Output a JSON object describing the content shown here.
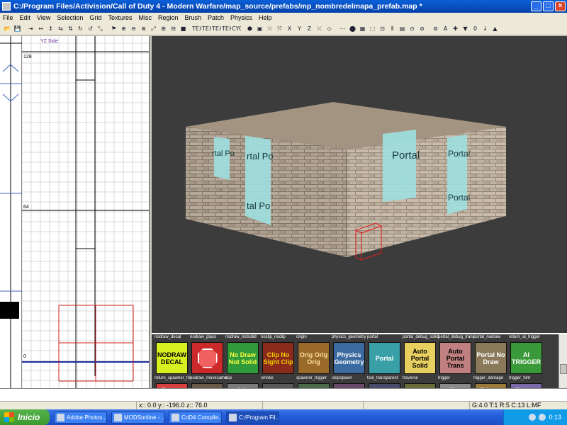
{
  "window": {
    "title": "C:/Program Files/Activision/Call of Duty 4 - Modern Warfare/map_source/prefabs/mp_nombredelmapa_prefab.map *",
    "min": "_",
    "max": "□",
    "close": "×"
  },
  "menu": [
    "File",
    "Edit",
    "View",
    "Selection",
    "Grid",
    "Textures",
    "Misc",
    "Region",
    "Brush",
    "Patch",
    "Physics",
    "Help"
  ],
  "toolbar": [
    "📂",
    "💾",
    "⇥",
    "↔",
    "↕",
    "⇆",
    "⇅",
    "↻",
    "↺",
    "⤡",
    "⚑",
    "⊕",
    "⊖",
    "⊗",
    "⤢",
    "⊞",
    "⊟",
    "■",
    "TEX",
    "TEX",
    "TEX",
    "TEX",
    "CYC",
    "⬢",
    "▣",
    "⤬",
    "⤧",
    "X",
    "Y",
    "Z",
    "⤫",
    "◇",
    "⋯",
    "⬤",
    "▦",
    "⬚",
    "⊡",
    "⫴",
    "▤",
    "⊙",
    "⊘",
    "⊚",
    "A",
    "✚",
    "▼",
    "0",
    "↓",
    "▲"
  ],
  "gridview": {
    "label": "YZ Side",
    "ruler_top": "128",
    "ruler_mid": "64",
    "ruler_low": "64",
    "ruler_zero": "0"
  },
  "camview": {
    "portals": [
      "Portal",
      "Portal",
      "Portal",
      "rtal Po",
      "rtal Po",
      "tal Po",
      "tal Po"
    ]
  },
  "textures": [
    {
      "name": "nodraw_decal",
      "tile": "NODRAW DECAL",
      "bg": "#d8f020",
      "fg": "#000000"
    },
    {
      "name": "nodraw_glass",
      "tile": "",
      "bg": "#cc2a2a",
      "fg": "#ffffff"
    },
    {
      "name": "nodraw_notsolid",
      "tile": "No Draw Not Solid",
      "bg": "#2e9a3a",
      "fg": "#ffff40"
    },
    {
      "name": "noclip_noclip",
      "tile": "Clip No Sight Clip",
      "bg": "#8a2a1a",
      "fg": "#f0d000"
    },
    {
      "name": "origin",
      "tile": "Orig Orig Orig",
      "bg": "#9a6a2a",
      "fg": "#ffe0a0"
    },
    {
      "name": "physics_geometry",
      "tile": "Physics Geometry",
      "bg": "#3a6aa0",
      "fg": "#ffffff"
    },
    {
      "name": "portal",
      "tile": "Portal",
      "bg": "#3aa0a8",
      "fg": "#ffffff"
    },
    {
      "name": "portal_debug_solid",
      "tile": "Auto Portal Solid",
      "bg": "#e8d060",
      "fg": "#000000"
    },
    {
      "name": "portal_debug_trans",
      "tile": "Auto Portal Trans",
      "bg": "#c08080",
      "fg": "#000000"
    },
    {
      "name": "portal_nodraw",
      "tile": "Portal No Draw",
      "bg": "#8a7a5a",
      "fg": "#ffffff"
    },
    {
      "name": "return_ai_trigger",
      "tile": "AI TRIGGER",
      "bg": "#3a9a3a",
      "fg": "#ffffff"
    }
  ],
  "textures_row2": [
    {
      "name": "return_spawner_trigger",
      "tile": "Return",
      "bg": "#d84040",
      "fg": "#ffffff"
    },
    {
      "name": "nodraw_movecarter",
      "tile": "",
      "bg": "#6a5a4a",
      "fg": "#ffffff"
    },
    {
      "name": "clip",
      "tile": "Clip",
      "bg": "#7a7a7a",
      "fg": "#ffffff"
    },
    {
      "name": "smoke",
      "tile": "",
      "bg": "#5a5a5a",
      "fg": "#ffffff"
    },
    {
      "name": "spawner_trigger",
      "tile": "",
      "bg": "#4a6a4a",
      "fg": "#ffffff"
    },
    {
      "name": "stopspawn",
      "tile": "",
      "bg": "#6a4a6a",
      "fg": "#ffffff"
    },
    {
      "name": "tool_transparent",
      "tile": "",
      "bg": "#4a4a6a",
      "fg": "#ffffff"
    },
    {
      "name": "traverse",
      "tile": "",
      "bg": "#6a6a3a",
      "fg": "#ffffff"
    },
    {
      "name": "trigger",
      "tile": "Trig",
      "bg": "#8a8a8a",
      "fg": "#ffffff"
    },
    {
      "name": "trigger_damage",
      "tile": "Trigger",
      "bg": "#9a7a3a",
      "fg": "#ffffff"
    },
    {
      "name": "trigger_hint",
      "tile": "Trigger",
      "bg": "#7a6aaa",
      "fg": "#ffffff"
    }
  ],
  "status": {
    "coords": "x:: 0.0  y:: -196.0  z:: 76.0",
    "grid": "G:4.0 T:1 R:5 C:13 L:MF"
  },
  "taskbar": {
    "start": "Inicio",
    "tasks": [
      "Adobe Photos...",
      "MODSonline - ...",
      "CoD4 Compile...",
      "C:/Program Fil..."
    ],
    "clock": "0:13"
  }
}
